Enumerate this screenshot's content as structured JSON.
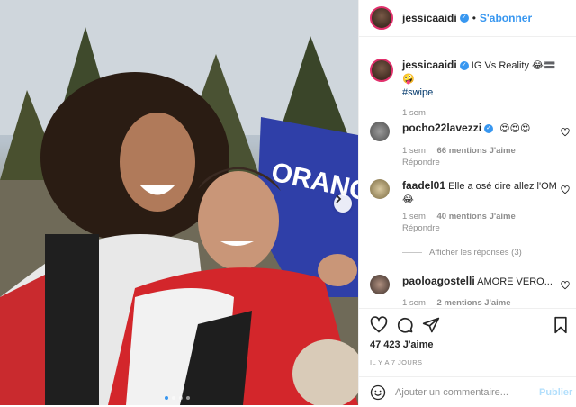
{
  "post": {
    "author": "jessicaaidi",
    "follow_label": "S'abonner",
    "dot_separator": "•",
    "caption_text": "IG Vs Reality 😂🟰🤪",
    "caption_hashtag": "#swipe",
    "caption_time": "1 sem",
    "carousel_dot_count": 4
  },
  "comments": [
    {
      "username": "pocho22lavezzi",
      "verified": true,
      "text": "😍😍😍",
      "time": "1 sem",
      "likes": "66 mentions J'aime",
      "reply_label": "Répondre"
    },
    {
      "username": "faadel01",
      "verified": false,
      "text": "Elle a osé dire allez l'OM 😂",
      "time": "1 sem",
      "likes": "40 mentions J'aime",
      "reply_label": "Répondre",
      "view_replies": "Afficher les réponses (3)"
    },
    {
      "username": "paoloagostelli",
      "verified": false,
      "text": "AMORE VERO...",
      "time": "1 sem",
      "likes": "2 mentions J'aime"
    }
  ],
  "actions": {
    "likes_count": "47 423 J'aime",
    "date": "IL Y A 7 JOURS",
    "comment_placeholder": "Ajouter un commentaire...",
    "publish_label": "Publier"
  },
  "photo": {
    "sign_text": "ORANGIN"
  },
  "colors": {
    "accent_blue": "#3897f0",
    "publish_disabled": "#b2dffc",
    "sign_blue": "#2f3fa8",
    "jacket_red": "#d3262b"
  }
}
